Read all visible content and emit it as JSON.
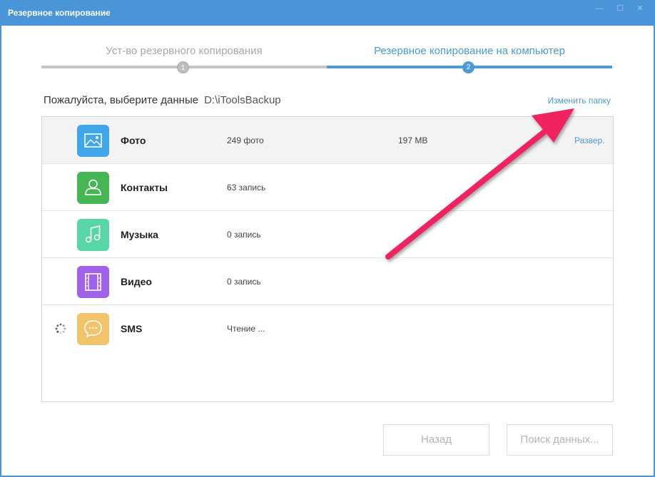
{
  "window": {
    "title": "Резервное копирование",
    "controls": {
      "minimize": "—",
      "maximize": "☐",
      "close": "✕"
    }
  },
  "steps": [
    {
      "number": "1",
      "label": "Уст-во резервного копирования",
      "active": false
    },
    {
      "number": "2",
      "label": "Резервное копирование на компьютер",
      "active": true
    }
  ],
  "selection": {
    "prompt": "Пожалуйста, выберите данные",
    "path": "D:\\iToolsBackup",
    "change_folder": "Изменить папку"
  },
  "items": [
    {
      "name": "Фото",
      "count": "249 фото",
      "size": "197 MB",
      "expand": "Развер.",
      "icon": "photo-icon",
      "color": "#3fa6ea"
    },
    {
      "name": "Контакты",
      "count": "63 запись",
      "icon": "contact-icon",
      "color": "#45b653"
    },
    {
      "name": "Музыка",
      "count": "0 запись",
      "icon": "music-icon",
      "color": "#59d6a6"
    },
    {
      "name": "Видео",
      "count": "0 запись",
      "icon": "video-icon",
      "color": "#a062e8"
    },
    {
      "name": "SMS",
      "count": "Чтение ...",
      "icon": "sms-icon",
      "color": "#f2c46a",
      "loading": true
    }
  ],
  "buttons": {
    "back": "Назад",
    "search": "Поиск данных..."
  },
  "colors": {
    "titlebar": "#4a94d8",
    "accent": "#4c9ad8",
    "arrow": "#f0205f"
  }
}
